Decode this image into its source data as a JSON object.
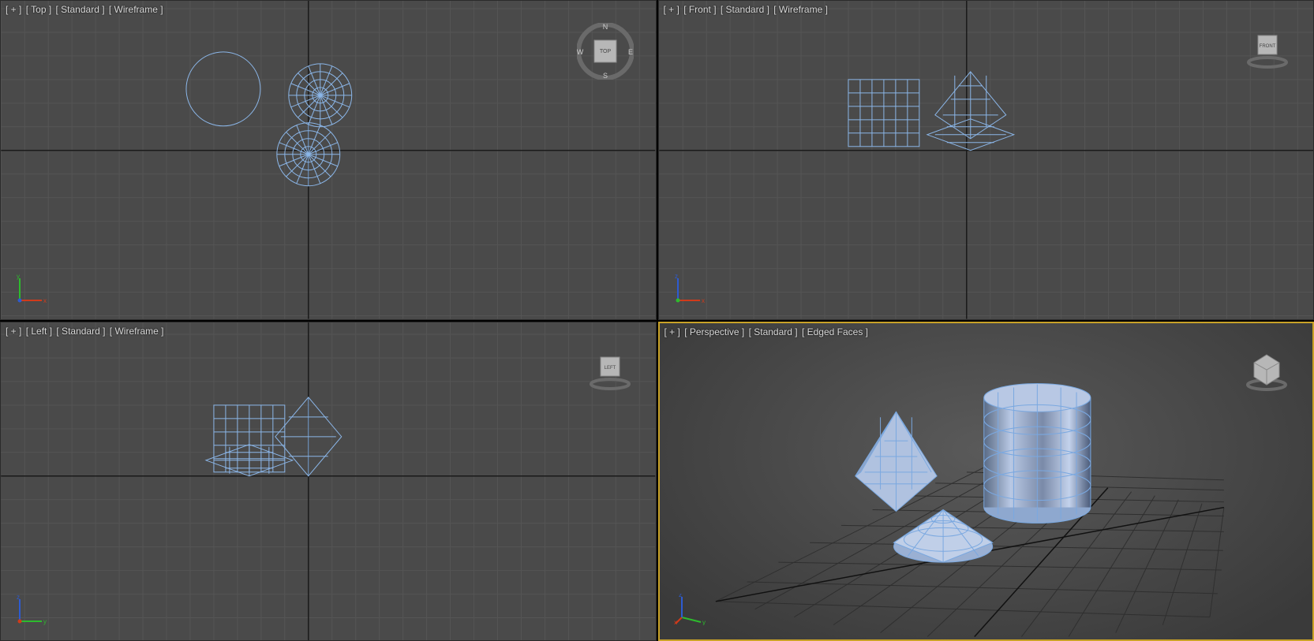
{
  "viewports": {
    "topLeft": {
      "maximize": "[ + ]",
      "view": "[ Top ]",
      "shading": "[ Standard ]",
      "mode": "[ Wireframe ]",
      "cube": "TOP",
      "compass": {
        "n": "N",
        "s": "S",
        "e": "E",
        "w": "W"
      }
    },
    "topRight": {
      "maximize": "[ + ]",
      "view": "[ Front ]",
      "shading": "[ Standard ]",
      "mode": "[ Wireframe ]",
      "cube": "FRONT"
    },
    "bottomLeft": {
      "maximize": "[ + ]",
      "view": "[ Left ]",
      "shading": "[ Standard ]",
      "mode": "[ Wireframe ]",
      "cube": "LEFT"
    },
    "bottomRight": {
      "maximize": "[ + ]",
      "view": "[ Perspective ]",
      "shading": "[ Standard ]",
      "mode": "[ Edged Faces ]"
    }
  },
  "colors": {
    "wireframe": "#8bb6e8",
    "gridMinor": "#555555",
    "gridMajor": "#3a3a3a",
    "axisX": "#d13a1a",
    "axisY": "#2dbb2d",
    "axisZ": "#2d5bd1",
    "activeBorder": "#c9a227",
    "viewportBg": "#4a4a4a"
  },
  "objects": [
    "Cylinder",
    "Hedra",
    "Cone-Flat"
  ]
}
